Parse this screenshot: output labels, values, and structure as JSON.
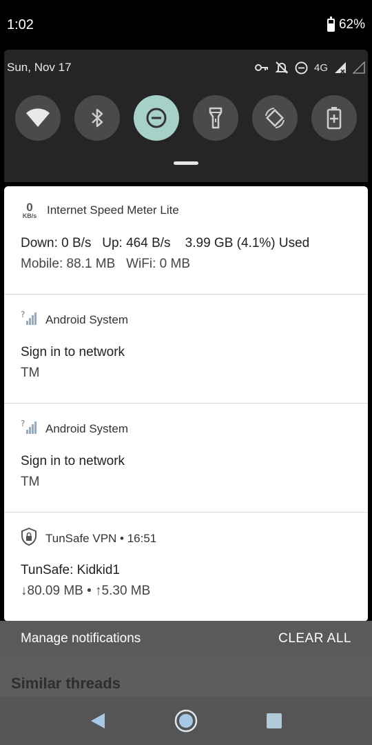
{
  "status_bar": {
    "time": "1:02",
    "battery": "62%"
  },
  "quick_settings": {
    "date": "Sun, Nov 17",
    "network_type": "4G",
    "tiles": [
      {
        "name": "wifi-tile",
        "icon": "wifi-icon",
        "active": false
      },
      {
        "name": "bluetooth-tile",
        "icon": "bluetooth-icon",
        "active": false
      },
      {
        "name": "do-not-disturb-tile",
        "icon": "do-not-disturb-icon",
        "active": true
      },
      {
        "name": "flashlight-tile",
        "icon": "flashlight-icon",
        "active": false
      },
      {
        "name": "auto-rotate-tile",
        "icon": "auto-rotate-icon",
        "active": false
      },
      {
        "name": "battery-saver-tile",
        "icon": "battery-saver-icon",
        "active": false
      }
    ],
    "colors": {
      "panel": "#252525",
      "tile": "#4a4a4a",
      "tile_active": "#a6d1c8"
    }
  },
  "notifications": [
    {
      "app": "Internet Speed Meter Lite",
      "icon_value": "0",
      "icon_unit": "KB/s",
      "line1": "Down: 0 B/s   Up: 464 B/s    3.99 GB (4.1%) Used",
      "line2": "Mobile: 88.1 MB   WiFi: 0 MB"
    },
    {
      "app": "Android System",
      "title": "Sign in to network",
      "text": "TM"
    },
    {
      "app": "Android System",
      "title": "Sign in to network",
      "text": "TM"
    },
    {
      "app": "TunSafe VPN • 16:51",
      "title": "TunSafe: Kidkid1",
      "text": "↓80.09 MB • ↑5.30 MB"
    }
  ],
  "footer": {
    "manage_label": "Manage notifications",
    "clear_label": "CLEAR ALL",
    "behind_text": "Similar threads"
  }
}
